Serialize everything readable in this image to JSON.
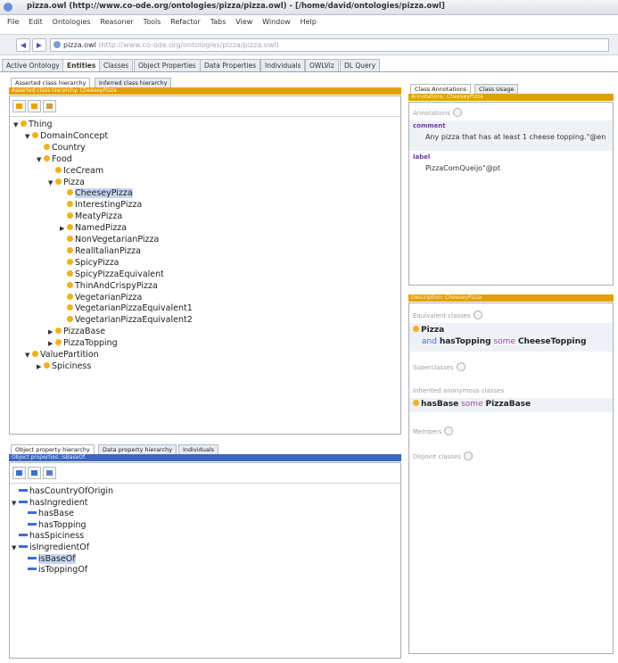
{
  "window": {
    "title": "pizza.owl (http://www.co-ode.org/ontologies/pizza/pizza.owl) - [/home/david/ontologies/pizza.owl]"
  },
  "menu": [
    "File",
    "Edit",
    "Ontologies",
    "Reasoner",
    "Tools",
    "Refactor",
    "Tabs",
    "View",
    "Window",
    "Help"
  ],
  "address": {
    "name": "pizza.owl",
    "iri": "(http://www.co-ode.org/ontologies/pizza/pizza.owl)"
  },
  "tabs": [
    "Active Ontology",
    "Entities",
    "Classes",
    "Object Properties",
    "Data Properties",
    "Individuals",
    "OWLViz",
    "DL Query"
  ],
  "class_panel": {
    "subtabs": [
      "Asserted class hierarchy",
      "Inferred class hierarchy"
    ],
    "header": "Asserted class hierarchy: CheeseyPizza",
    "tree": [
      {
        "label": "Thing",
        "depth": 0,
        "arrow": "▼"
      },
      {
        "label": "DomainConcept",
        "depth": 1,
        "arrow": "▼"
      },
      {
        "label": "Country",
        "depth": 2,
        "arrow": ""
      },
      {
        "label": "Food",
        "depth": 2,
        "arrow": "▼"
      },
      {
        "label": "IceCream",
        "depth": 3,
        "arrow": ""
      },
      {
        "label": "Pizza",
        "depth": 3,
        "arrow": "▼"
      },
      {
        "label": "CheeseyPizza",
        "depth": 4,
        "arrow": "",
        "selected": true
      },
      {
        "label": "InterestingPizza",
        "depth": 4,
        "arrow": ""
      },
      {
        "label": "MeatyPizza",
        "depth": 4,
        "arrow": ""
      },
      {
        "label": "NamedPizza",
        "depth": 4,
        "arrow": "▶"
      },
      {
        "label": "NonVegetarianPizza",
        "depth": 4,
        "arrow": ""
      },
      {
        "label": "RealItalianPizza",
        "depth": 4,
        "arrow": ""
      },
      {
        "label": "SpicyPizza",
        "depth": 4,
        "arrow": ""
      },
      {
        "label": "SpicyPizzaEquivalent",
        "depth": 4,
        "arrow": ""
      },
      {
        "label": "ThinAndCrispyPizza",
        "depth": 4,
        "arrow": ""
      },
      {
        "label": "VegetarianPizza",
        "depth": 4,
        "arrow": ""
      },
      {
        "label": "VegetarianPizzaEquivalent1",
        "depth": 4,
        "arrow": ""
      },
      {
        "label": "VegetarianPizzaEquivalent2",
        "depth": 4,
        "arrow": ""
      },
      {
        "label": "PizzaBase",
        "depth": 3,
        "arrow": "▶"
      },
      {
        "label": "PizzaTopping",
        "depth": 3,
        "arrow": "▶"
      },
      {
        "label": "ValuePartition",
        "depth": 1,
        "arrow": "▼"
      },
      {
        "label": "Spiciness",
        "depth": 2,
        "arrow": "▶"
      }
    ]
  },
  "property_panel": {
    "subtabs": [
      "Object property hierarchy",
      "Data property hierarchy",
      "Individuals"
    ],
    "header": "Object properties: isBaseOf",
    "tree": [
      {
        "label": "hasCountryOfOrigin",
        "depth": 0,
        "arrow": ""
      },
      {
        "label": "hasIngredient",
        "depth": 0,
        "arrow": "▼"
      },
      {
        "label": "hasBase",
        "depth": 1,
        "arrow": ""
      },
      {
        "label": "hasTopping",
        "depth": 1,
        "arrow": ""
      },
      {
        "label": "hasSpiciness",
        "depth": 0,
        "arrow": ""
      },
      {
        "label": "isIngredientOf",
        "depth": 0,
        "arrow": "▼"
      },
      {
        "label": "isBaseOf",
        "depth": 1,
        "arrow": "",
        "selected": true
      },
      {
        "label": "isToppingOf",
        "depth": 1,
        "arrow": ""
      }
    ]
  },
  "annotations_panel": {
    "subtabs": [
      "Class Annotations",
      "Class Usage"
    ],
    "header": "Annotations: CheeseyPizza",
    "annotations_label": "Annotations",
    "comment_key": "comment",
    "comment_value": "Any pizza that has at least 1 cheese topping.\"@en",
    "label_key": "label",
    "label_value": "PizzaComQueijo\"@pt"
  },
  "description_panel": {
    "header": "Description: CheeseyPizza",
    "equivalent_label": "Equivalent classes",
    "equiv_class": "Pizza",
    "equiv_and": "and",
    "equiv_prop": "hasTopping",
    "equiv_some": "some",
    "equiv_filler": "CheeseTopping",
    "superclasses_label": "Superclasses",
    "inherited_label": "Inherited anonymous classes",
    "inherited_prop": "hasBase",
    "inherited_some": "some",
    "inherited_filler": "PizzaBase",
    "members_label": "Members",
    "disjoint_label": "Disjoint classes"
  }
}
